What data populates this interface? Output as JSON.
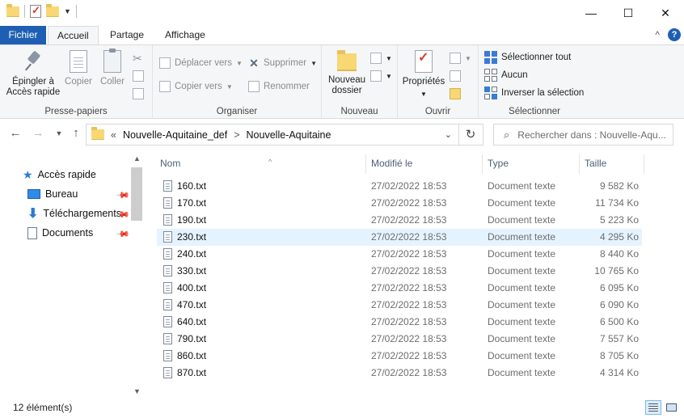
{
  "window": {
    "minimize": "—",
    "maximize": "☐",
    "close": "✕"
  },
  "ribbon_tabs": {
    "file": "Fichier",
    "home": "Accueil",
    "share": "Partage",
    "view": "Affichage",
    "collapse": "^",
    "help": "?"
  },
  "ribbon": {
    "clipboard": {
      "pin_label_1": "Épingler à",
      "pin_label_2": "Accès rapide",
      "copy": "Copier",
      "paste": "Coller",
      "group": "Presse-papiers"
    },
    "organize": {
      "move_to": "Déplacer vers",
      "copy_to": "Copier vers",
      "delete": "Supprimer",
      "rename": "Renommer",
      "group": "Organiser"
    },
    "new": {
      "new_folder_1": "Nouveau",
      "new_folder_2": "dossier",
      "group": "Nouveau"
    },
    "open": {
      "properties": "Propriétés",
      "group": "Ouvrir"
    },
    "select": {
      "select_all": "Sélectionner tout",
      "select_none": "Aucun",
      "invert": "Inverser la sélection",
      "group": "Sélectionner"
    }
  },
  "address": {
    "overflow": "«",
    "crumb1": "Nouvelle-Aquitaine_def",
    "sep": ">",
    "crumb2": "Nouvelle-Aquitaine",
    "search_placeholder": "Rechercher dans : Nouvelle-Aqu..."
  },
  "nav": {
    "quick_access": "Accès rapide",
    "items": [
      {
        "label": "Bureau"
      },
      {
        "label": "Téléchargements"
      },
      {
        "label": "Documents"
      }
    ]
  },
  "columns": {
    "name": "Nom",
    "modified": "Modifié le",
    "type": "Type",
    "size": "Taille"
  },
  "files": [
    {
      "name": "160.txt",
      "modified": "27/02/2022 18:53",
      "type": "Document texte",
      "size": "9 582 Ko"
    },
    {
      "name": "170.txt",
      "modified": "27/02/2022 18:53",
      "type": "Document texte",
      "size": "11 734 Ko"
    },
    {
      "name": "190.txt",
      "modified": "27/02/2022 18:53",
      "type": "Document texte",
      "size": "5 223 Ko"
    },
    {
      "name": "230.txt",
      "modified": "27/02/2022 18:53",
      "type": "Document texte",
      "size": "4 295 Ko"
    },
    {
      "name": "240.txt",
      "modified": "27/02/2022 18:53",
      "type": "Document texte",
      "size": "8 440 Ko"
    },
    {
      "name": "330.txt",
      "modified": "27/02/2022 18:53",
      "type": "Document texte",
      "size": "10 765 Ko"
    },
    {
      "name": "400.txt",
      "modified": "27/02/2022 18:53",
      "type": "Document texte",
      "size": "6 095 Ko"
    },
    {
      "name": "470.txt",
      "modified": "27/02/2022 18:53",
      "type": "Document texte",
      "size": "6 090 Ko"
    },
    {
      "name": "640.txt",
      "modified": "27/02/2022 18:53",
      "type": "Document texte",
      "size": "6 500 Ko"
    },
    {
      "name": "790.txt",
      "modified": "27/02/2022 18:53",
      "type": "Document texte",
      "size": "7 557 Ko"
    },
    {
      "name": "860.txt",
      "modified": "27/02/2022 18:53",
      "type": "Document texte",
      "size": "8 705 Ko"
    },
    {
      "name": "870.txt",
      "modified": "27/02/2022 18:53",
      "type": "Document texte",
      "size": "4 314 Ko"
    }
  ],
  "status": {
    "count": "12 élément(s)"
  },
  "colors": {
    "accent": "#1e5fb3",
    "hover_row": "#e5f3ff",
    "folder": "#f8d775"
  }
}
